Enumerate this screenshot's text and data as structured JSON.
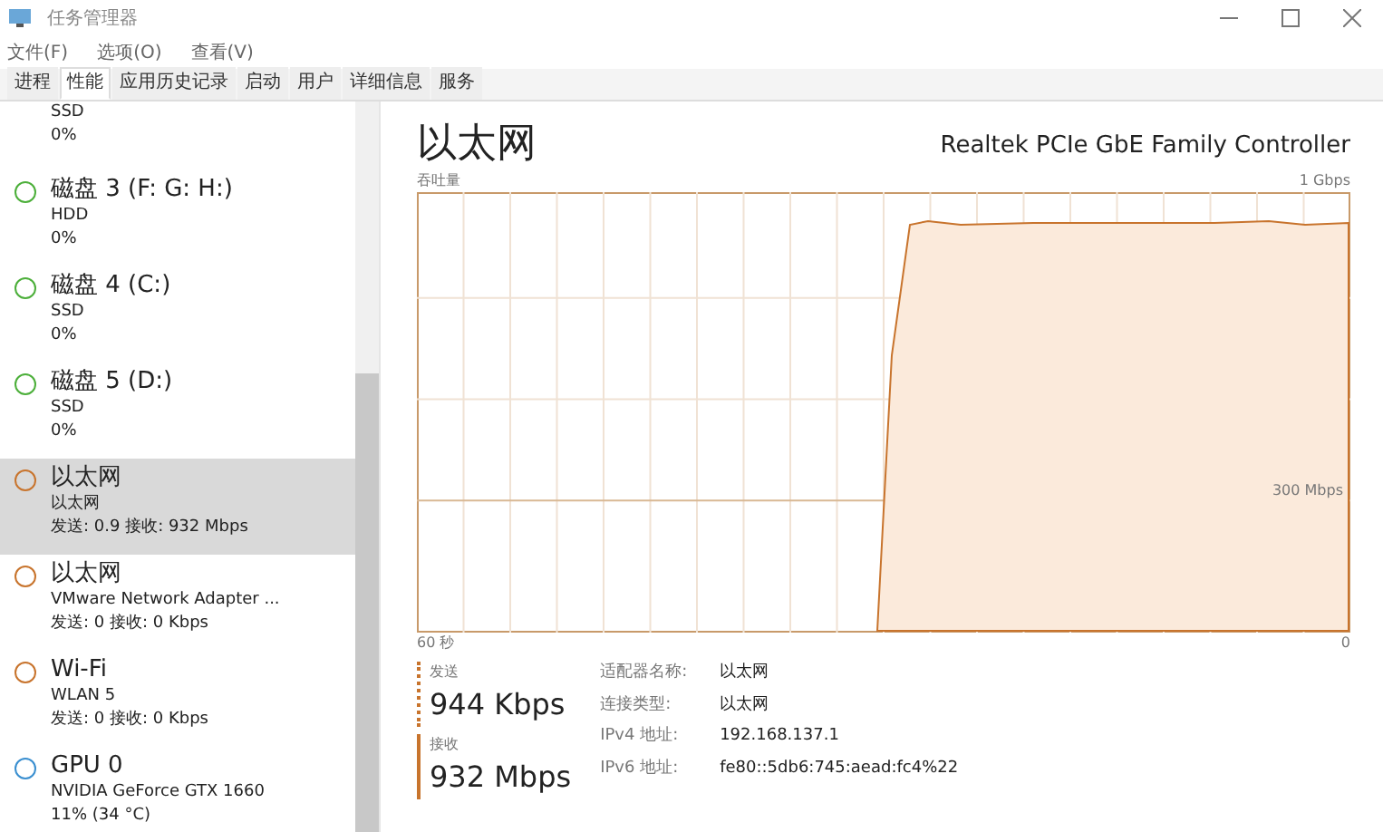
{
  "window": {
    "title": "任务管理器"
  },
  "menu": [
    "文件(F)",
    "选项(O)",
    "查看(V)"
  ],
  "tabs": [
    {
      "label": "进程",
      "selected": false
    },
    {
      "label": "性能",
      "selected": true
    },
    {
      "label": "应用历史记录",
      "selected": false
    },
    {
      "label": "启动",
      "selected": false
    },
    {
      "label": "用户",
      "selected": false
    },
    {
      "label": "详细信息",
      "selected": false
    },
    {
      "label": "服务",
      "selected": false
    }
  ],
  "sidebar": {
    "items": [
      {
        "subtitle": "SSD",
        "reading": "0%",
        "selected": false
      },
      {
        "name": "磁盘 3 (F: G: H:)",
        "subtitle": "HDD",
        "reading": "0%",
        "color": "#4caf3a",
        "selected": false
      },
      {
        "name": "磁盘 4 (C:)",
        "subtitle": "SSD",
        "reading": "0%",
        "color": "#4caf3a",
        "selected": false
      },
      {
        "name": "磁盘 5 (D:)",
        "subtitle": "SSD",
        "reading": "0%",
        "color": "#4caf3a",
        "selected": false
      },
      {
        "name": "以太网",
        "subtitle": "以太网",
        "reading": "发送: 0.9 接收: 932 Mbps",
        "color": "#c8742d",
        "selected": true
      },
      {
        "name": "以太网",
        "subtitle": "VMware Network Adapter ...",
        "reading": "发送: 0 接收: 0 Kbps",
        "color": "#c8742d",
        "selected": false
      },
      {
        "name": "Wi-Fi",
        "subtitle": "WLAN 5",
        "reading": "发送: 0 接收: 0 Kbps",
        "color": "#c8742d",
        "selected": false
      },
      {
        "name": "GPU 0",
        "subtitle": "NVIDIA GeForce GTX 1660",
        "reading": "11% (34 °C)",
        "color": "#3a8fd0",
        "selected": false
      }
    ]
  },
  "detail": {
    "title": "以太网",
    "device": "Realtek PCIe GbE Family Controller",
    "graph": {
      "label": "吞吐量",
      "max": "1 Gbps",
      "mid_label": "300 Mbps",
      "time_start": "60 秒",
      "time_end": "0"
    },
    "send": {
      "label": "发送",
      "value": "944 Kbps"
    },
    "receive": {
      "label": "接收",
      "value": "932 Mbps"
    },
    "properties": [
      {
        "label": "适配器名称:",
        "value": "以太网"
      },
      {
        "label": "连接类型:",
        "value": "以太网"
      },
      {
        "label": "IPv4 地址:",
        "value": "192.168.137.1"
      },
      {
        "label": "IPv6 地址:",
        "value": "fe80::5db6:745:aead:fc4%22"
      }
    ]
  }
}
